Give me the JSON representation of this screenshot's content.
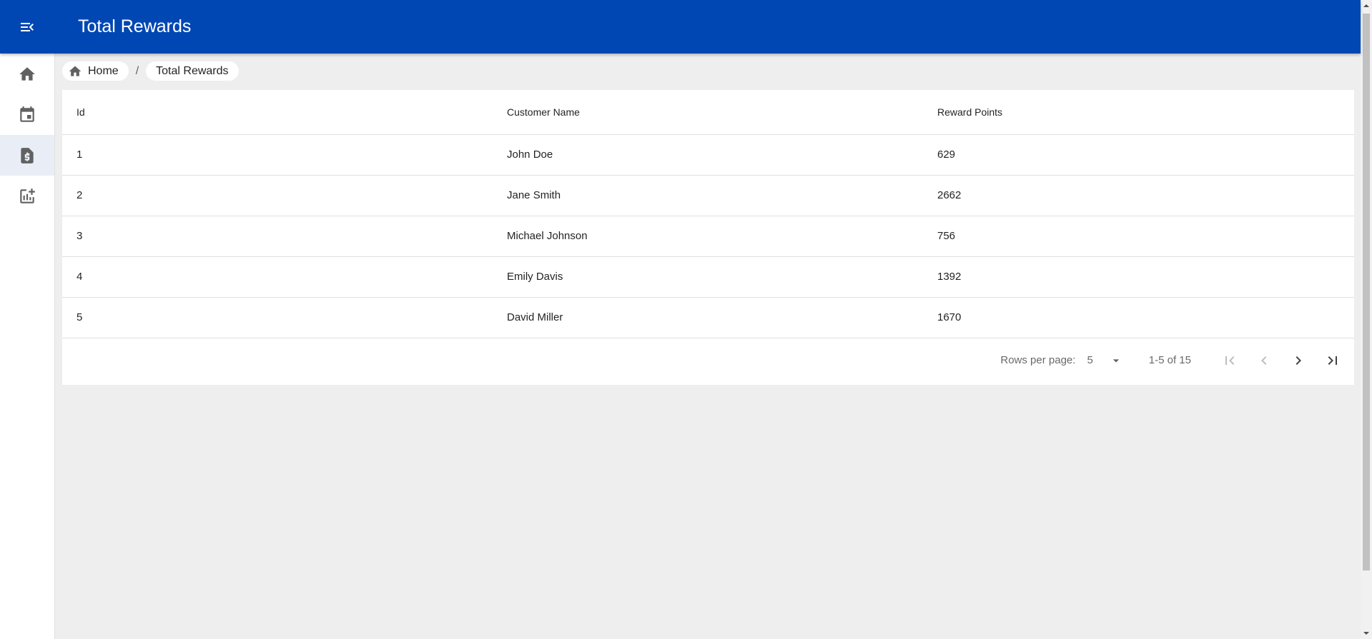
{
  "app": {
    "title": "Total Rewards",
    "brand_color": "#0047b3"
  },
  "header": {
    "menu_icon": "menu-open-icon"
  },
  "sidebar": {
    "items": [
      {
        "name": "home",
        "icon": "home-icon",
        "active": false
      },
      {
        "name": "calendar",
        "icon": "calendar-icon",
        "active": false
      },
      {
        "name": "rewards",
        "icon": "receipt-dollar-icon",
        "active": true
      },
      {
        "name": "add-report",
        "icon": "add-chart-icon",
        "active": false
      }
    ]
  },
  "breadcrumb": {
    "home_label": "Home",
    "separator": "/",
    "current_label": "Total Rewards"
  },
  "table": {
    "columns": [
      "Id",
      "Customer Name",
      "Reward Points"
    ],
    "rows": [
      [
        "1",
        "John Doe",
        "629"
      ],
      [
        "2",
        "Jane Smith",
        "2662"
      ],
      [
        "3",
        "Michael Johnson",
        "756"
      ],
      [
        "4",
        "Emily Davis",
        "1392"
      ],
      [
        "5",
        "David Miller",
        "1670"
      ]
    ]
  },
  "pagination": {
    "rows_per_page_label": "Rows per page:",
    "rows_per_page_value": "5",
    "range_text": "1-5 of 15",
    "first_disabled": true,
    "prev_disabled": true,
    "next_disabled": false,
    "last_disabled": false
  }
}
